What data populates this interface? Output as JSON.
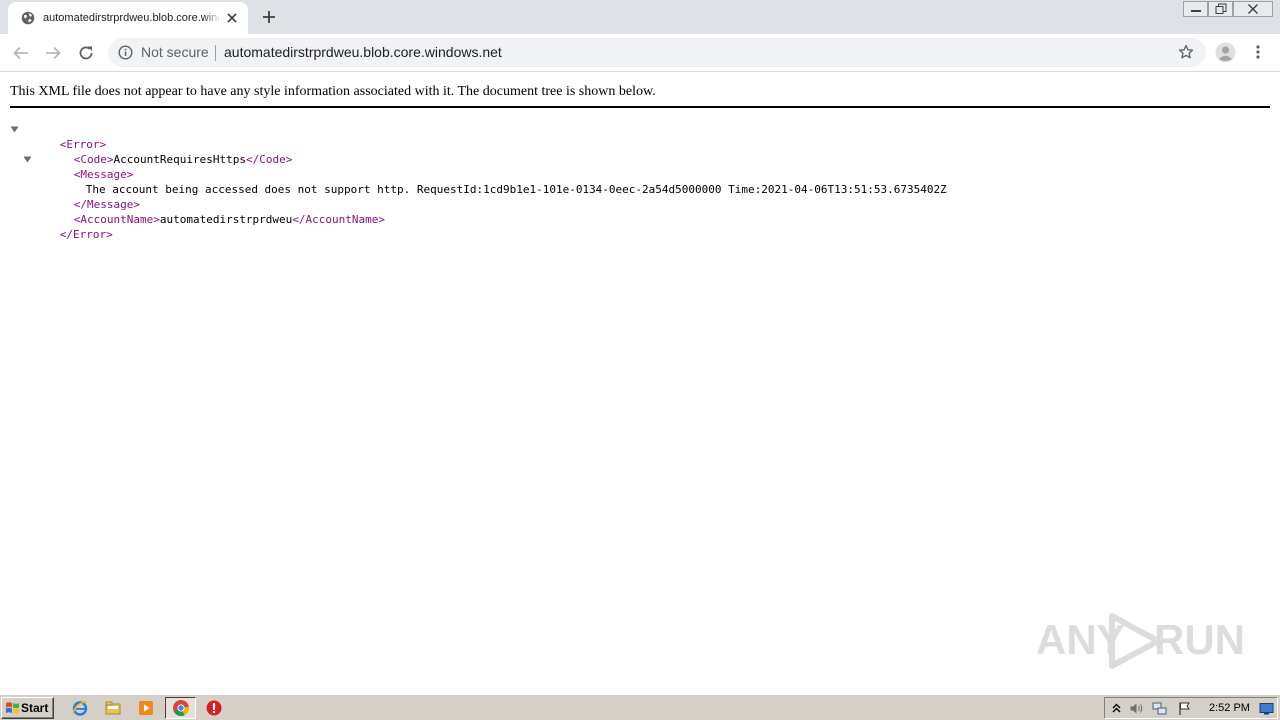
{
  "browser": {
    "tab_title": "automatedirstrprdweu.blob.core.windows.net",
    "security_label": "Not secure",
    "url": "automatedirstrprdweu.blob.core.windows.net"
  },
  "page": {
    "notice": "This XML file does not appear to have any style information associated with it. The document tree is shown below.",
    "xml": {
      "error_open": "<Error>",
      "error_close": "</Error>",
      "code_open": "<Code>",
      "code_value": "AccountRequiresHttps",
      "code_close": "</Code>",
      "message_open": "<Message>",
      "message_value": "The account being accessed does not support http. RequestId:1cd9b1e1-101e-0134-0eec-2a54d5000000 Time:2021-04-06T13:51:53.6735402Z",
      "message_close": "</Message>",
      "account_open": "<AccountName>",
      "account_value": "automatedirstrprdweu",
      "account_close": "</AccountName>"
    },
    "watermark": {
      "left": "ANY",
      "right": "RUN"
    }
  },
  "taskbar": {
    "start_label": "Start",
    "clock": "2:52 PM",
    "pinned_icons": [
      "ie-icon",
      "explorer-icon",
      "media-player-icon",
      "chrome-icon",
      "stop-icon"
    ]
  },
  "colors": {
    "xml_tag": "#881280",
    "titlebar": "#dee1e6",
    "omnibox": "#f1f3f4",
    "taskbar": "#d4d0c8"
  }
}
